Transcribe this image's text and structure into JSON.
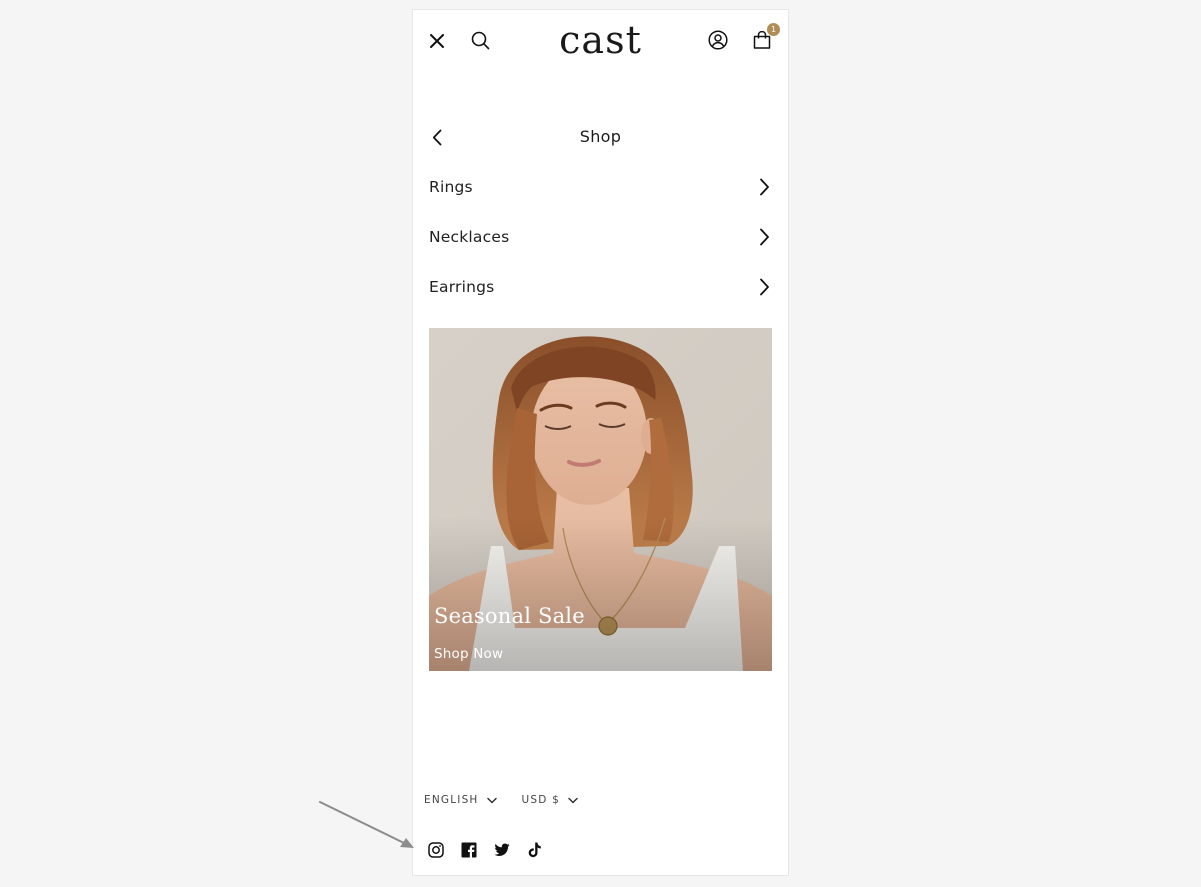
{
  "header": {
    "logo_text": "cast",
    "cart_count": "1",
    "badge_color": "#b08d57",
    "icons": [
      "close-icon",
      "search-icon",
      "account-icon",
      "cart-icon"
    ]
  },
  "submenu": {
    "title": "Shop",
    "back_icon": "chevron-left-icon"
  },
  "menu": {
    "items": [
      {
        "label": "Rings"
      },
      {
        "label": "Necklaces"
      },
      {
        "label": "Earrings"
      }
    ]
  },
  "promo": {
    "title": "Seasonal Sale",
    "link_label": "Shop Now",
    "image_alt": "Model wearing gold coin pendant necklace"
  },
  "localization": {
    "language": "ENGLISH",
    "currency": "USD $"
  },
  "social": {
    "icons": [
      "instagram-icon",
      "facebook-icon",
      "twitter-icon",
      "tiktok-icon"
    ]
  },
  "colors": {
    "background": "#f5f5f5",
    "text": "#1a1a1a",
    "accent": "#b08d57"
  }
}
